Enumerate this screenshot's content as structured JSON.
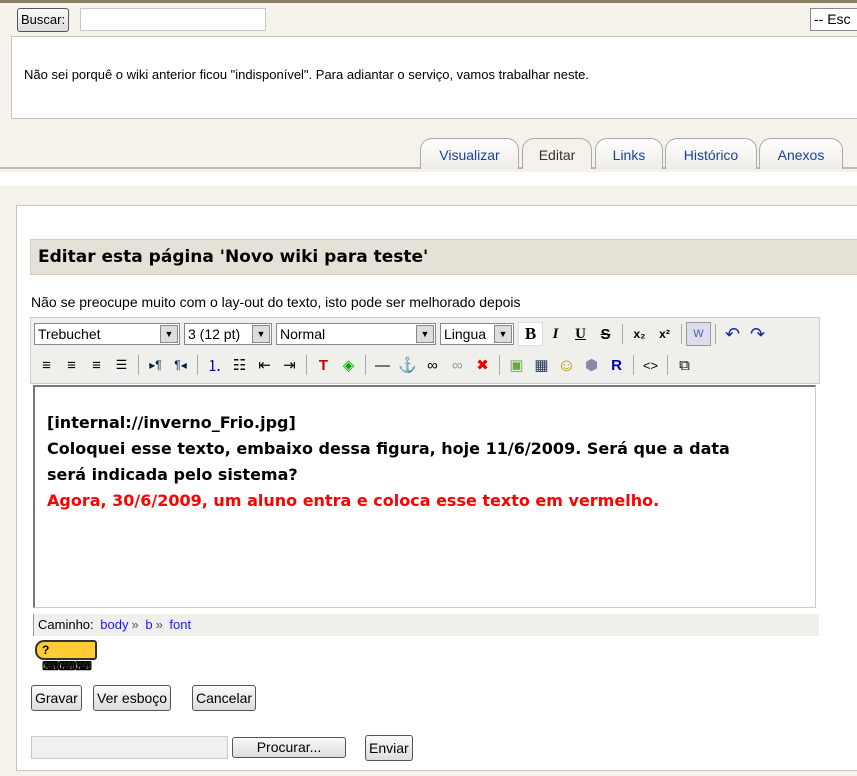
{
  "search": {
    "button": "Buscar:",
    "value": "",
    "select": "-- Esc"
  },
  "notice": "Não sei porquê o wiki anterior ficou \"indisponível\". Para adiantar o serviço, vamos trabalhar neste.",
  "tabs": [
    {
      "label": "Visualizar"
    },
    {
      "label": "Editar",
      "active": true
    },
    {
      "label": "Links"
    },
    {
      "label": "Histórico"
    },
    {
      "label": "Anexos"
    }
  ],
  "heading": "Editar esta página 'Novo wiki para teste'",
  "description": "Não se preocupe muito com o lay-out do texto, isto pode ser melhorado depois",
  "toolbar": {
    "font": "Trebuchet",
    "size": "3 (12 pt)",
    "format": "Normal",
    "language": "Lingua",
    "row1": [
      "bold-icon",
      "italic-icon",
      "underline-icon",
      "strikethrough-icon",
      "|",
      "subscript-icon",
      "superscript-icon",
      "|",
      "paste-word-icon",
      "|",
      "undo-icon",
      "redo-icon"
    ],
    "row2": [
      "align-left-icon",
      "align-center-icon",
      "align-right-icon",
      "justify-icon",
      "|",
      "ltr-icon",
      "rtl-icon",
      "|",
      "ordered-list-icon",
      "unordered-list-icon",
      "outdent-icon",
      "indent-icon",
      "|",
      "text-color-icon",
      "background-color-icon",
      "|",
      "horizontal-rule-icon",
      "anchor-icon",
      "link-icon",
      "unlink-icon",
      "remove-link-icon",
      "|",
      "image-icon",
      "table-icon",
      "smiley-icon",
      "special-char-icon",
      "find-replace-icon",
      "|",
      "html-source-icon",
      "|",
      "fullscreen-icon"
    ]
  },
  "editor": {
    "line1": "[internal://inverno_Frio.jpg]",
    "line2": "Coloquei esse texto, embaixo dessa figura, hoje 11/6/2009. Será que a data será indicada pelo sistema?",
    "line3": "Agora, 30/6/2009, um aluno entra e coloca esse texto em vermelho.",
    "red": "#ff0000"
  },
  "path": {
    "label": "Caminho:",
    "items": [
      "body",
      "b",
      "font"
    ],
    "sep": "»"
  },
  "help": "?",
  "buttons": {
    "save": "Gravar",
    "draft": "Ver esboço",
    "cancel": "Cancelar"
  },
  "upload": {
    "browse": "Procurar...",
    "send": "Enviar"
  }
}
